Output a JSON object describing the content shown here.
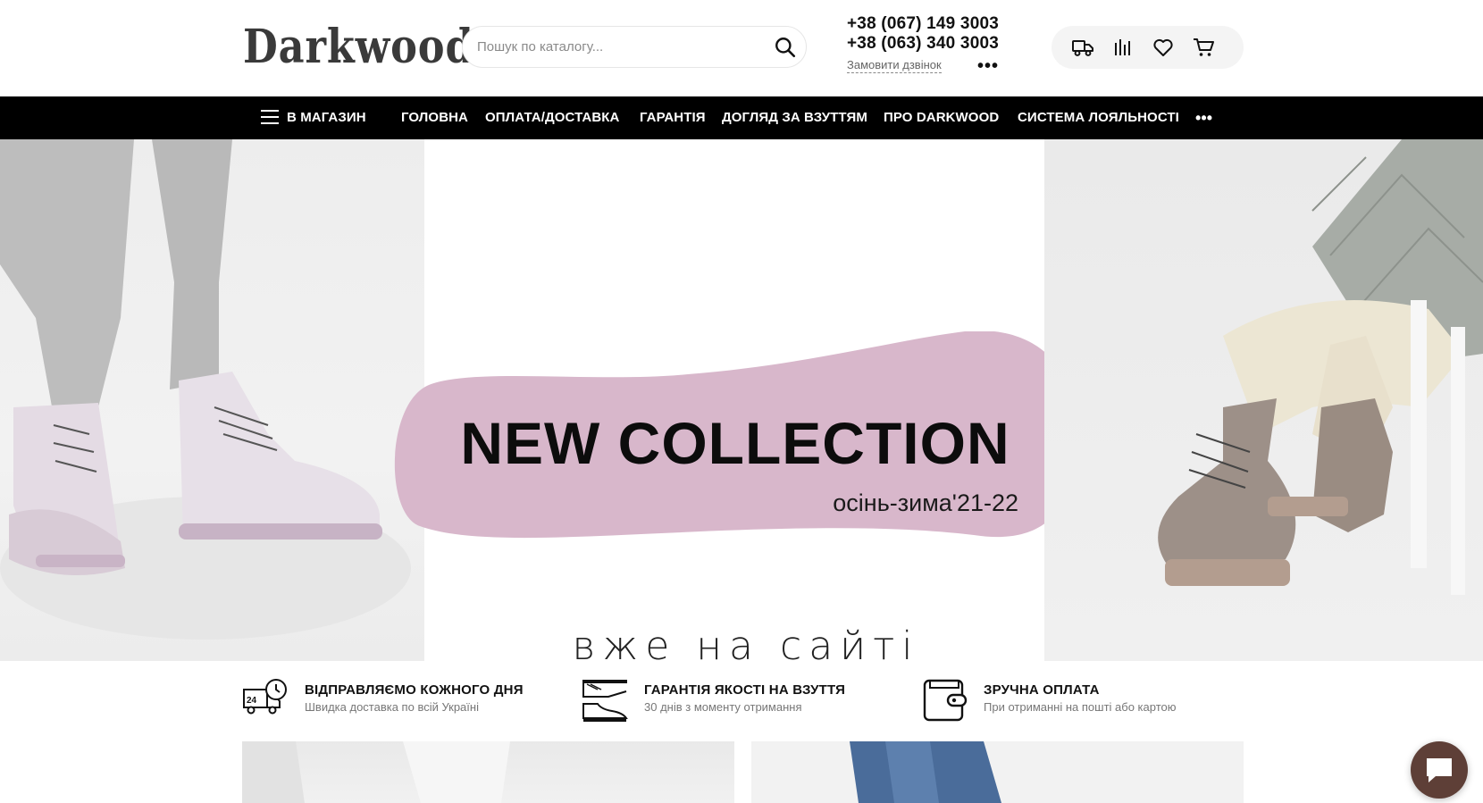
{
  "header": {
    "logo_text": "Darkwood",
    "search": {
      "placeholder": "Пошук по каталогу..."
    },
    "phones": [
      "+38 (067) 149 3003",
      "+38 (063) 340 3003"
    ],
    "callback_label": "Замовити дзвінок",
    "more_label": "•••",
    "actions": [
      {
        "icon": "truck-icon"
      },
      {
        "icon": "compare-icon"
      },
      {
        "icon": "heart-icon"
      },
      {
        "icon": "cart-icon"
      }
    ]
  },
  "nav": {
    "catalog_label": "В МАГАЗИН",
    "items": [
      "ГОЛОВНА",
      "ОПЛАТА/ДОСТАВКА",
      "ГАРАНТІЯ",
      "ДОГЛЯД ЗА ВЗУТТЯМ",
      "ПРО DARKWOOD",
      "СИСТЕМА ЛОЯЛЬНОСТІ"
    ],
    "more_label": "•••"
  },
  "hero": {
    "title": "NEW COLLECTION",
    "subtitle": "осінь-зима'21-22",
    "tagline": "вже на сайті",
    "blob_color": "#d8b7cb"
  },
  "features": [
    {
      "icon": "delivery-24-icon",
      "title": "ВІДПРАВЛЯЄМО КОЖНОГО ДНЯ",
      "subtitle": "Швидка доставка по всій Україні"
    },
    {
      "icon": "shoe-quality-icon",
      "title": "ГАРАНТІЯ ЯКОСТІ НА ВЗУТТЯ",
      "subtitle": "30 днів з моменту отримання"
    },
    {
      "icon": "wallet-icon",
      "title": "ЗРУЧНА ОПЛАТА",
      "subtitle": "При отриманні на пошті або картою"
    }
  ],
  "chat": {
    "icon": "chat-bubble-icon",
    "color": "#5e3f37"
  }
}
